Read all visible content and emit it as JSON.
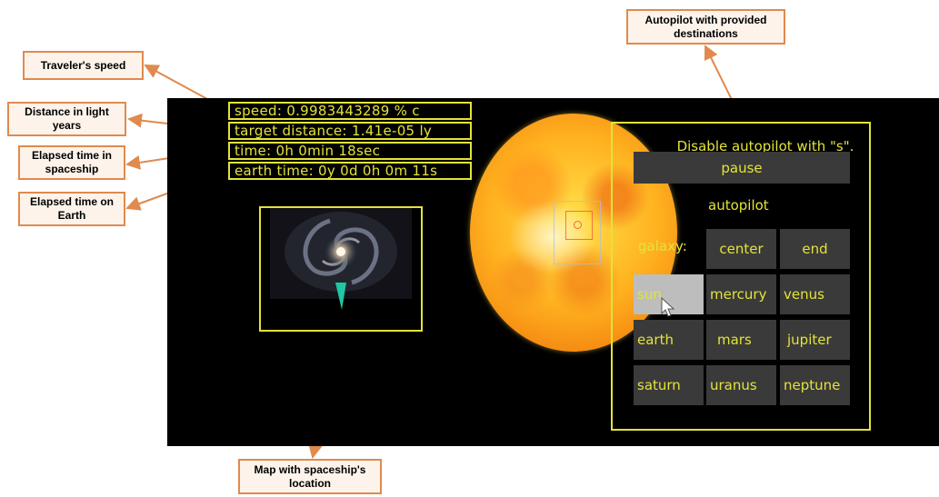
{
  "callouts": {
    "speed": "Traveler's speed",
    "distance": "Distance in light years",
    "ship_time": "Elapsed time in spaceship",
    "earth_time": "Elapsed time on Earth",
    "autopilot": "Autopilot with provided destinations",
    "map": "Map with spaceship's location"
  },
  "hud": {
    "speed": "speed: 0.9983443289  % c",
    "target_distance": "target distance: 1.41e-05  ly",
    "time": "time: 0h  0min  18sec",
    "earth_time": "earth time: 0y 0d  0h  0m  11s"
  },
  "autopilot": {
    "disable_hint": "Disable autopilot with \"s\".",
    "pause_label": "pause",
    "heading": "autopilot",
    "galaxy_label": "galaxy:",
    "galaxy_buttons": [
      "center",
      "end"
    ],
    "planet_buttons": [
      "sun",
      "mercury",
      "venus",
      "earth",
      "mars",
      "jupiter",
      "saturn",
      "uranus",
      "neptune"
    ],
    "selected": "sun"
  },
  "colors": {
    "hud_yellow": "#e3e33a",
    "callout_border": "#e08a4e",
    "callout_fill": "#fdf3ea",
    "button_bg": "#3a3a3a",
    "selected_button_bg": "#bdbdbd"
  }
}
